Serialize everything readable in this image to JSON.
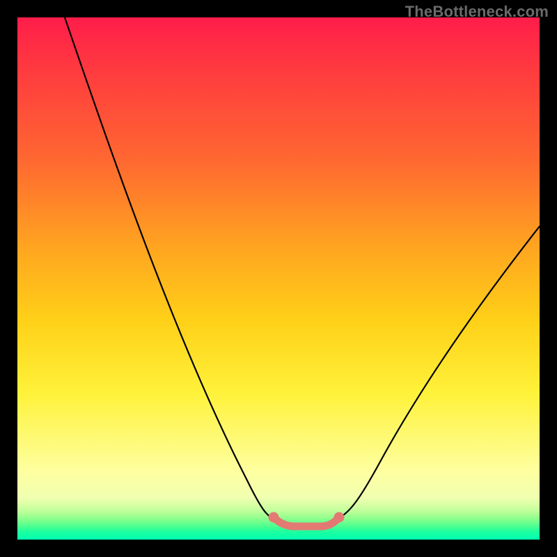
{
  "watermark": {
    "text": "TheBottleneck.com"
  },
  "chart_data": {
    "type": "line",
    "title": "",
    "xlabel": "",
    "ylabel": "",
    "xlim": [
      0,
      100
    ],
    "ylim": [
      0,
      100
    ],
    "annotations": [],
    "gradient_stops": [
      {
        "pos": 0,
        "color": "#ff1d4a"
      },
      {
        "pos": 10,
        "color": "#ff3a3f"
      },
      {
        "pos": 28,
        "color": "#ff6a30"
      },
      {
        "pos": 45,
        "color": "#ffa81f"
      },
      {
        "pos": 58,
        "color": "#ffd018"
      },
      {
        "pos": 72,
        "color": "#fff23a"
      },
      {
        "pos": 87,
        "color": "#feffa0"
      },
      {
        "pos": 92,
        "color": "#f0ffb0"
      },
      {
        "pos": 94.5,
        "color": "#c1ff9b"
      },
      {
        "pos": 96,
        "color": "#8cff8c"
      },
      {
        "pos": 97.5,
        "color": "#4aff90"
      },
      {
        "pos": 98.5,
        "color": "#1cffa0"
      },
      {
        "pos": 100,
        "color": "#00ffb0"
      }
    ],
    "series": [
      {
        "name": "bottleneck-curve",
        "x": [
          10,
          15,
          20,
          25,
          30,
          35,
          40,
          45,
          49,
          51,
          55,
          58,
          60,
          63,
          67,
          72,
          78,
          85,
          92,
          100
        ],
        "y": [
          100,
          88,
          76,
          64,
          52,
          40,
          28,
          16,
          6,
          4,
          3,
          3,
          4,
          6,
          12,
          20,
          30,
          40,
          50,
          60
        ]
      }
    ],
    "flat_region": {
      "x_start": 49,
      "x_end": 61,
      "y": 3
    },
    "flat_marker_color": "#e27a73"
  }
}
